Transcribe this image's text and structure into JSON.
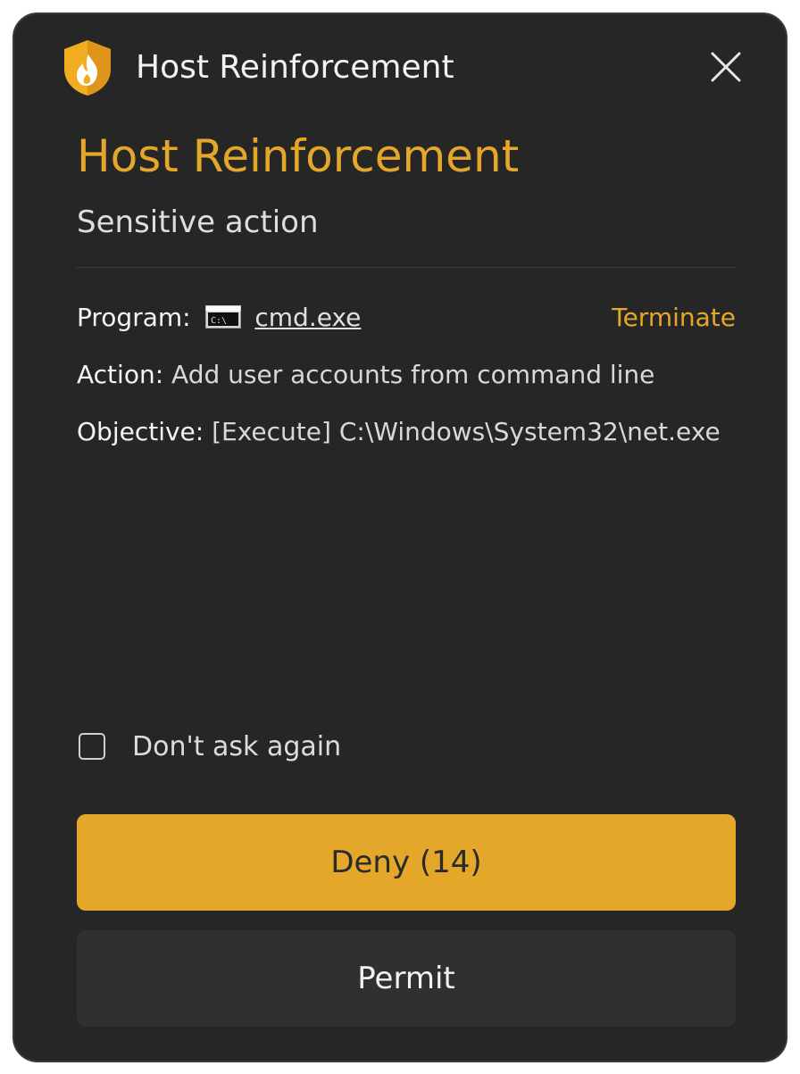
{
  "window": {
    "title": "Host Reinforcement",
    "app_icon": "shield-flame-icon",
    "close_icon": "close-icon"
  },
  "heading": "Host Reinforcement",
  "subheading": "Sensitive action",
  "details": {
    "program_label": "Program:",
    "program_icon": "cmd-icon",
    "program_value": "cmd.exe",
    "terminate_label": "Terminate",
    "action_label": "Action:",
    "action_value": "Add user accounts from command line",
    "objective_label": "Objective:",
    "objective_value": "[Execute] C:\\Windows\\System32\\net.exe"
  },
  "options": {
    "dont_ask_label": "Don't ask again",
    "dont_ask_checked": false
  },
  "buttons": {
    "deny_label": "Deny (14)",
    "permit_label": "Permit"
  },
  "colors": {
    "accent": "#e5a72a",
    "background": "#262626",
    "secondary_button": "#303030"
  }
}
